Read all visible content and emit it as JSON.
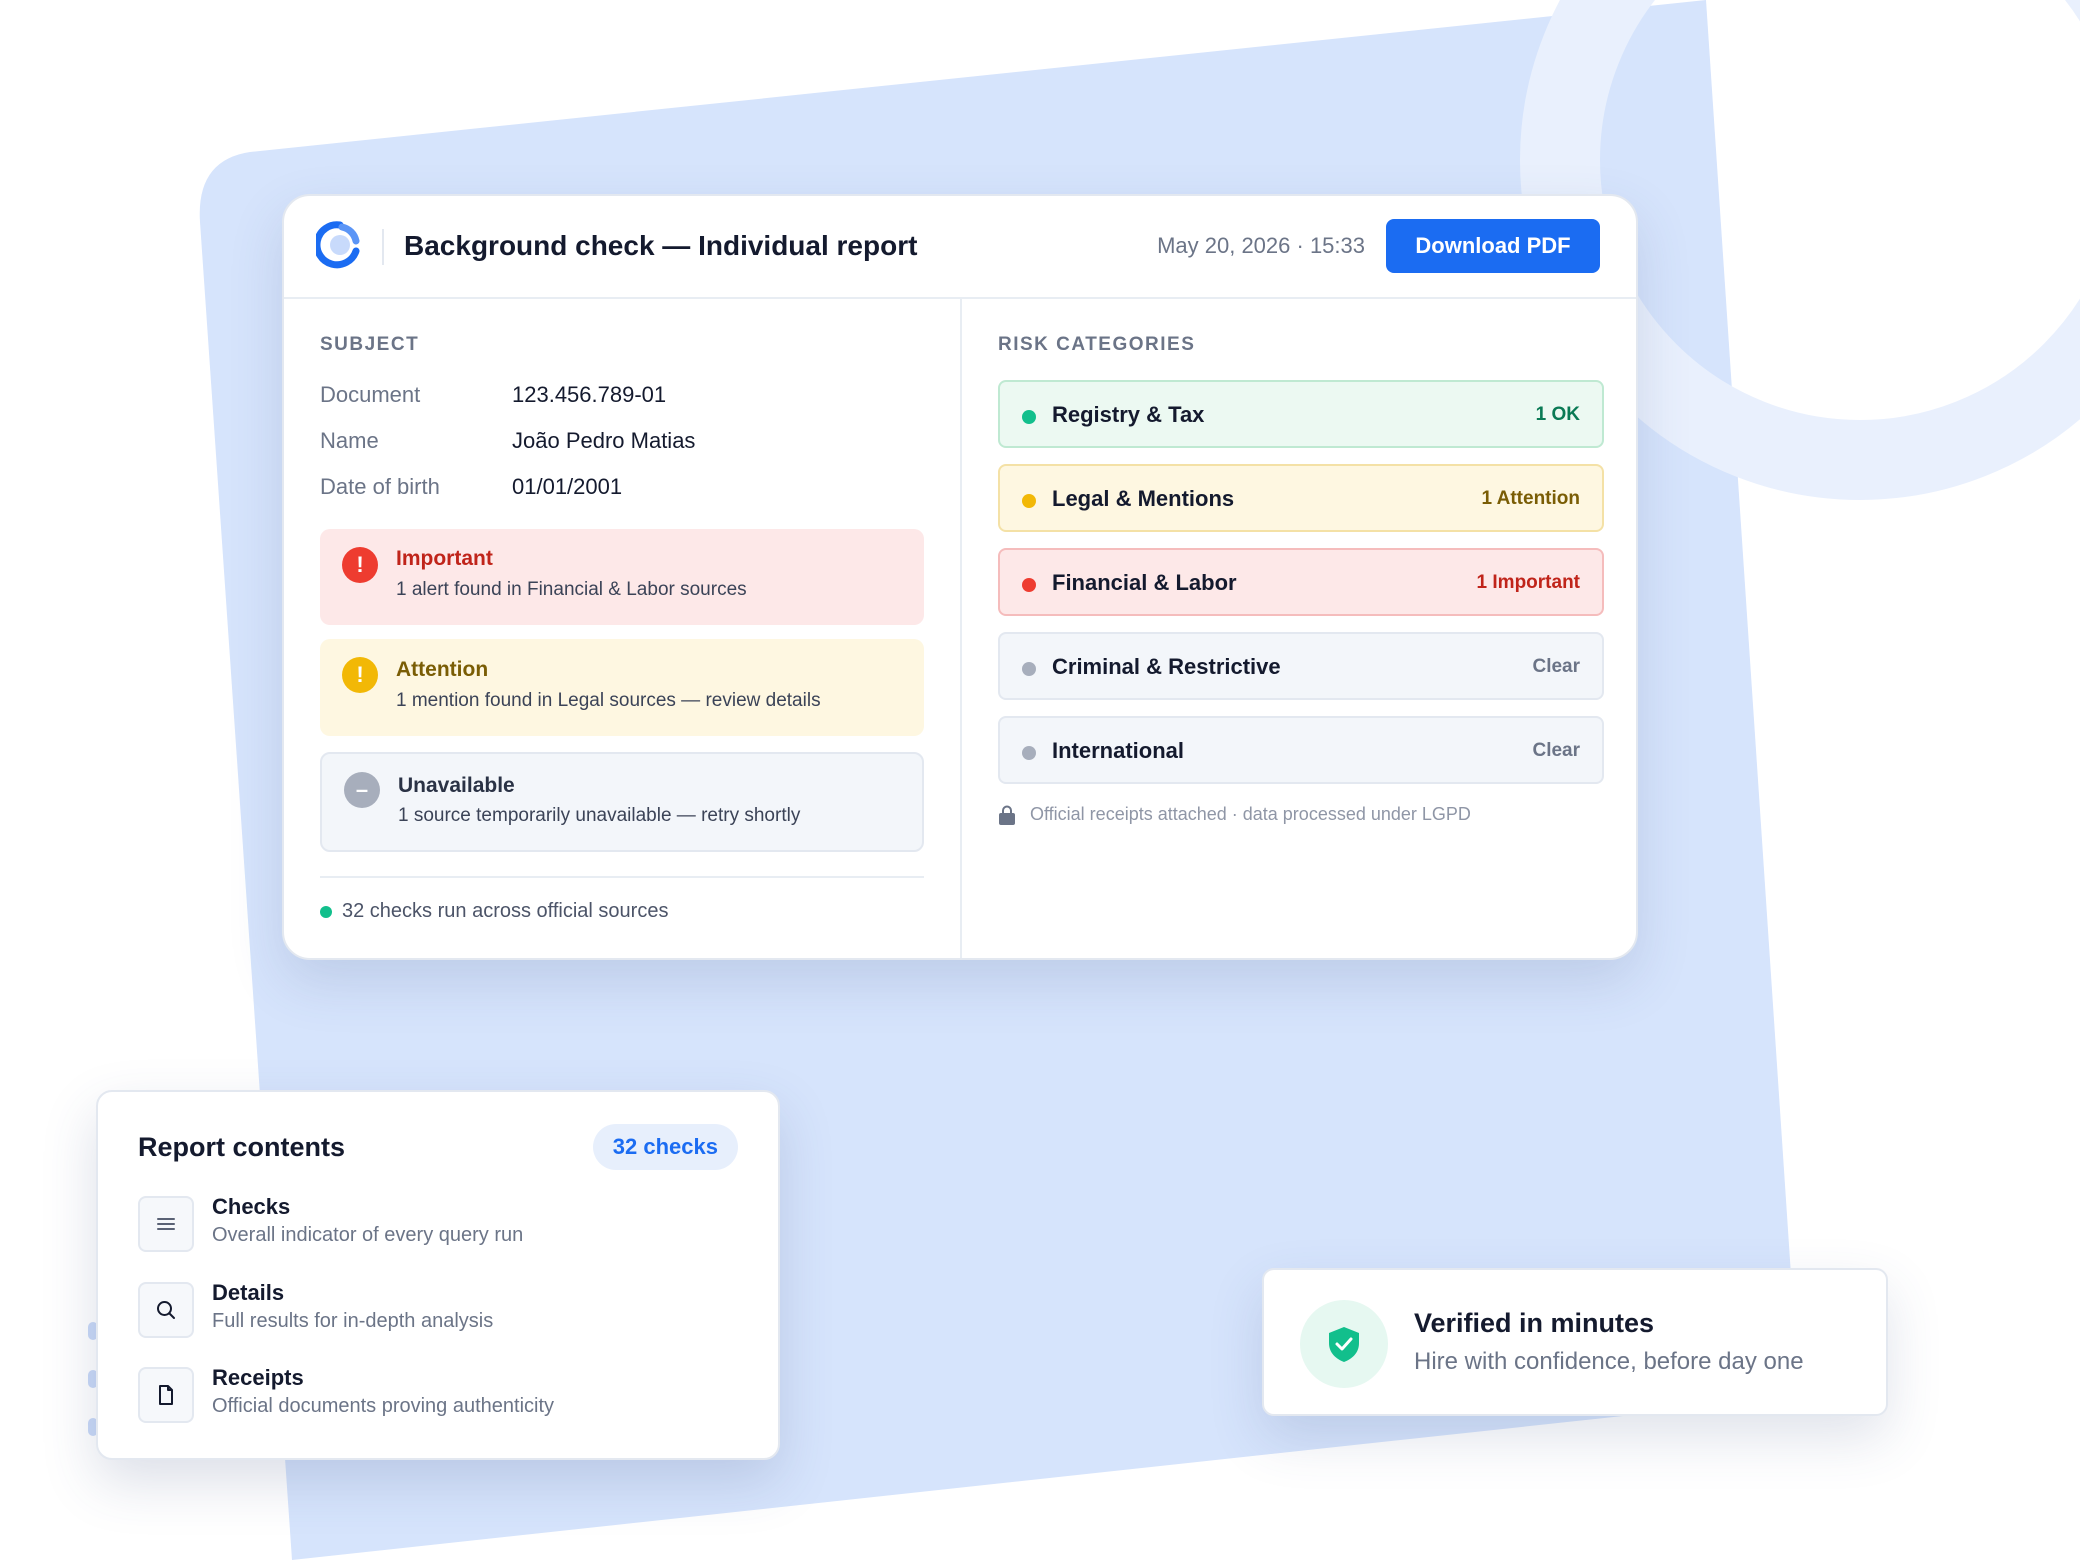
{
  "header": {
    "title": "Background check — Individual report",
    "timestamp": "May 20, 2026 · 15:33",
    "download_label": "Download PDF"
  },
  "subject": {
    "label": "SUBJECT",
    "fields": [
      {
        "key": "Document",
        "value": "123.456.789-01"
      },
      {
        "key": "Name",
        "value": "João Pedro Matias"
      },
      {
        "key": "Date of birth",
        "value": "01/01/2001"
      }
    ]
  },
  "alerts": [
    {
      "glyph": "!",
      "title": "Important",
      "desc": "1 alert found in Financial & Labor sources",
      "color": "#ee3c30"
    },
    {
      "glyph": "!",
      "title": "Attention",
      "desc": "1 mention found in Legal sources — review details",
      "color": "#f2b806"
    },
    {
      "glyph": "–",
      "title": "Unavailable",
      "desc": "1 source temporarily unavailable — retry shortly",
      "color": "#a7aebc"
    }
  ],
  "checks_footer": "32 checks run across official sources",
  "risk": {
    "label": "RISK CATEGORIES",
    "categories": [
      {
        "name": "Registry & Tax",
        "status": "1 OK",
        "color": "#12bf8c"
      },
      {
        "name": "Legal & Mentions",
        "status": "1 Attention",
        "color": "#f2b806"
      },
      {
        "name": "Financial & Labor",
        "status": "1 Important",
        "color": "#ee3c30"
      },
      {
        "name": "Criminal & Restrictive",
        "status": "Clear",
        "color": "#a7aebc"
      },
      {
        "name": "International",
        "status": "Clear",
        "color": "#a7aebc"
      }
    ],
    "receipt_note": "Official receipts attached · data processed under LGPD"
  },
  "contents": {
    "title": "Report contents",
    "badge": "32 checks",
    "items": [
      {
        "icon": "list-icon",
        "title": "Checks",
        "desc": "Overall indicator of every query run"
      },
      {
        "icon": "search-icon",
        "title": "Details",
        "desc": "Full results for in-depth analysis"
      },
      {
        "icon": "document-icon",
        "title": "Receipts",
        "desc": "Official documents proving authenticity"
      }
    ]
  },
  "verified": {
    "icon": "shield-check-icon",
    "title": "Verified in minutes",
    "desc": "Hire with confidence, before day one"
  },
  "colors": {
    "accent": "#1b6cf2",
    "background_panel": "#d6e4fc",
    "ok": "#12bf8c",
    "attention": "#f2b806",
    "important": "#ee3c30",
    "neutral": "#a7aebc"
  }
}
